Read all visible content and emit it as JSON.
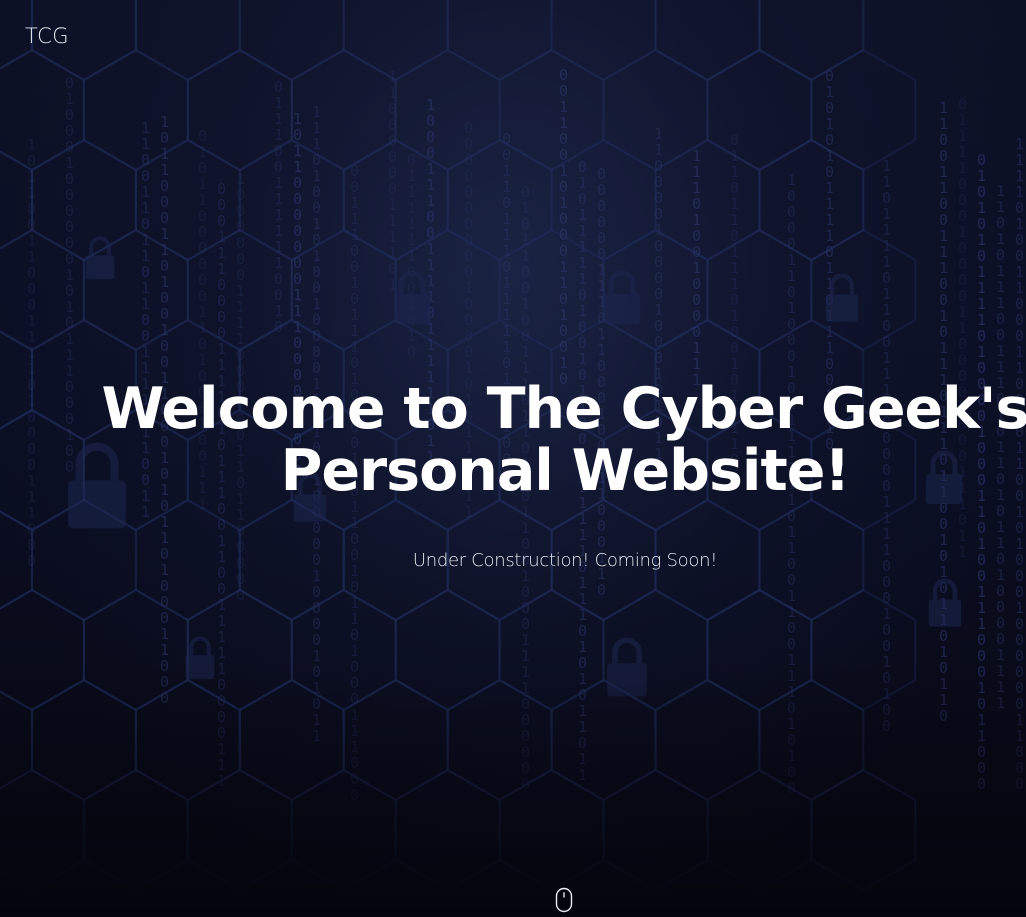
{
  "header": {
    "brand": "TCG"
  },
  "hero": {
    "title_line1": "Welcome to The Cyber Geek's",
    "title_line2": "Personal Website!",
    "subtitle": "Under Construction! Coming Soon!"
  },
  "icons": {
    "scroll": "mouse-scroll-icon",
    "background_padlock": "padlock-icon"
  },
  "colors": {
    "background": "#0b0e1f",
    "text": "#ffffff",
    "binary_digits": "#2a3566",
    "hex_grid": "#1f2a55"
  }
}
